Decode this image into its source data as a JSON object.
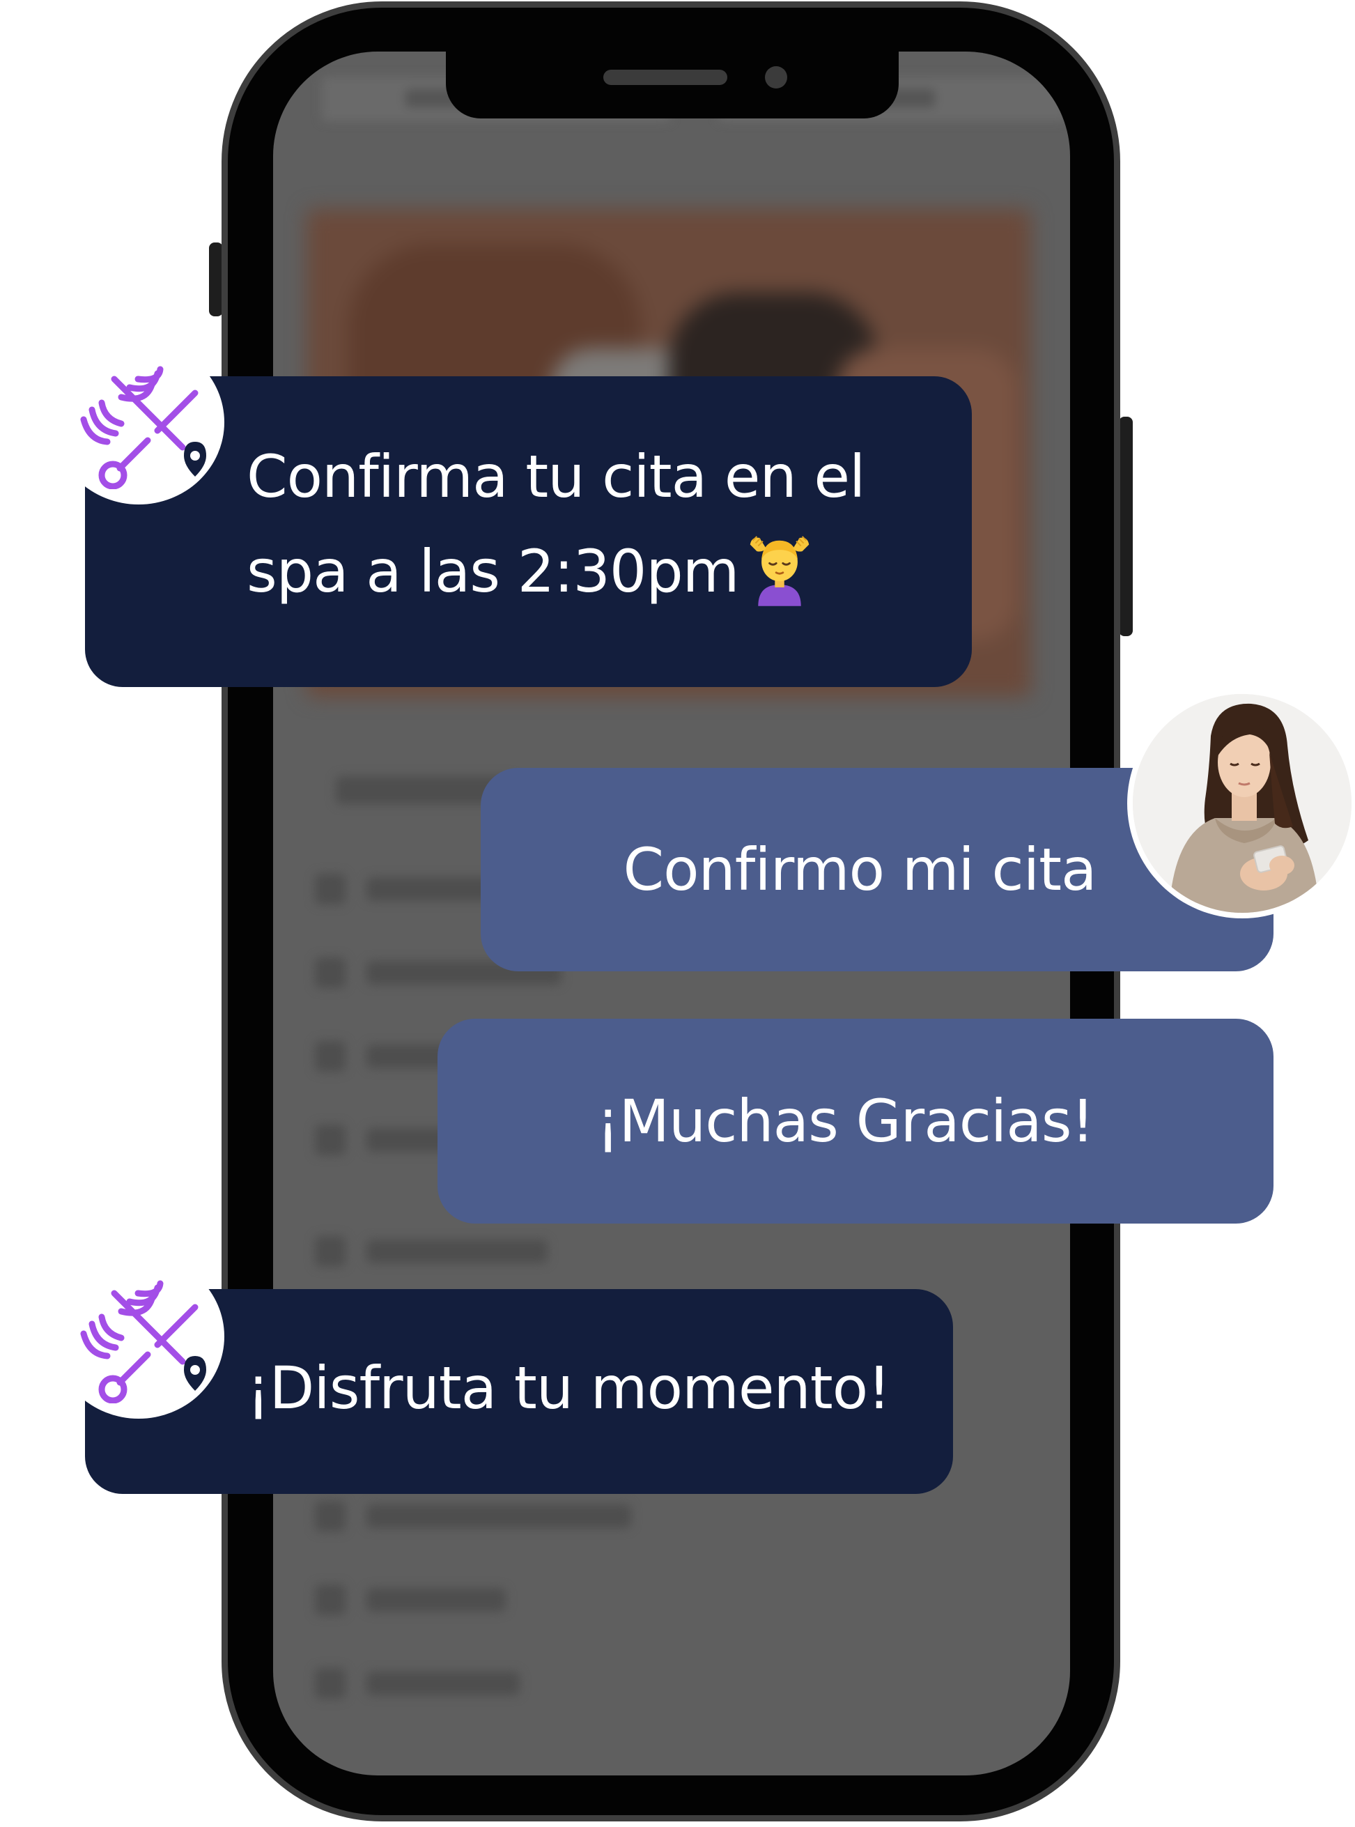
{
  "chat": {
    "messages": [
      {
        "from": "business",
        "line1": "Confirma tu cita en el",
        "line2": "spa a las 2:30pm",
        "emoji": "person-getting-massage-emoji"
      },
      {
        "from": "user",
        "text": "Confirmo mi cita"
      },
      {
        "from": "user",
        "text": "¡Muchas Gracias!"
      },
      {
        "from": "business",
        "text": "¡Disfruta tu momento!"
      }
    ]
  },
  "icons": {
    "business_logo": "scissors-hair-location-pin-logo",
    "user_avatar": "woman-with-phone-avatar",
    "emoji": "person-getting-massage-emoji"
  },
  "colors": {
    "business_bubble": "#131e3d",
    "user_bubble": "#4c5d8d",
    "logo_purple": "#a34ee7",
    "logo_dark": "#131e3d",
    "phone_frame": "#030303",
    "screen_overlay": "#5f5f5f"
  }
}
